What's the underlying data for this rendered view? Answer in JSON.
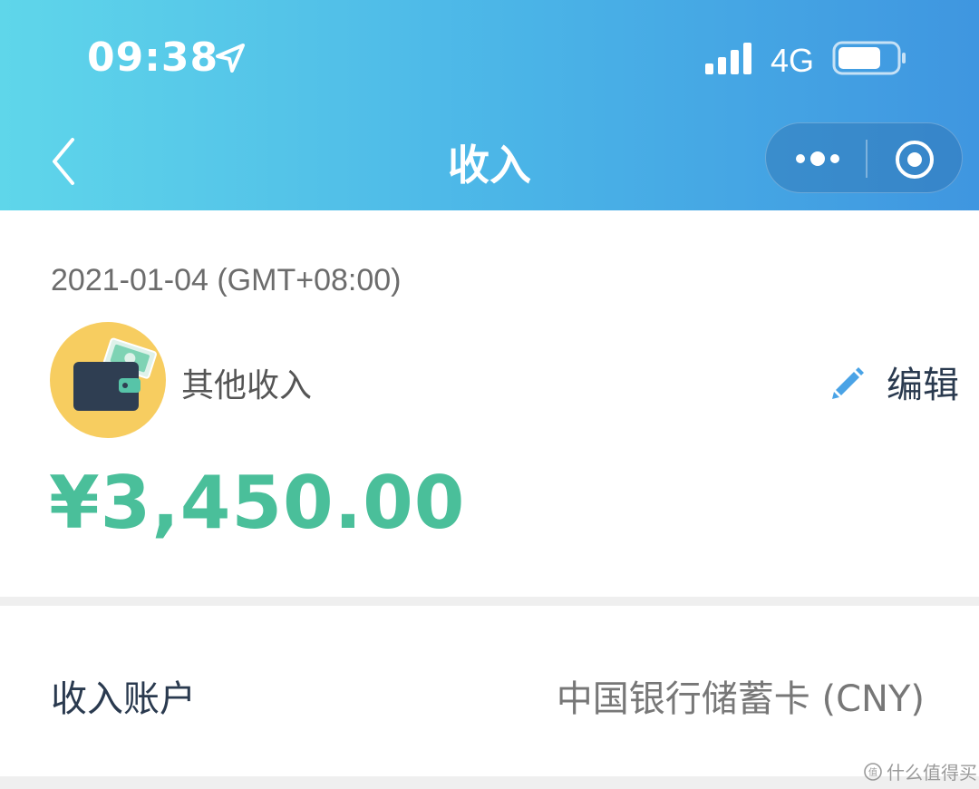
{
  "status_bar": {
    "time": "09:38",
    "network": "4G",
    "icons": [
      "location-arrow-icon",
      "signal-icon",
      "battery-icon"
    ]
  },
  "nav": {
    "title": "收入",
    "back_icon": "chevron-left-icon",
    "capsule_icons": [
      "more-icon",
      "target-icon"
    ]
  },
  "record": {
    "date": "2021-01-04 (GMT+08:00)",
    "category": "其他收入",
    "category_icon": "wallet-icon",
    "edit_label": "编辑",
    "amount": "¥3,450.00"
  },
  "account": {
    "label": "收入账户",
    "value": "中国银行储蓄卡 (CNY)"
  },
  "watermark": {
    "text": "什么值得买"
  },
  "colors": {
    "header_gradient_start": "#5fd6ea",
    "header_gradient_end": "#3f96e0",
    "amount": "#4abf9a",
    "avatar_bg": "#f7cd60",
    "edit_icon": "#4aa3e6",
    "dark_text": "#2a3a4f"
  }
}
